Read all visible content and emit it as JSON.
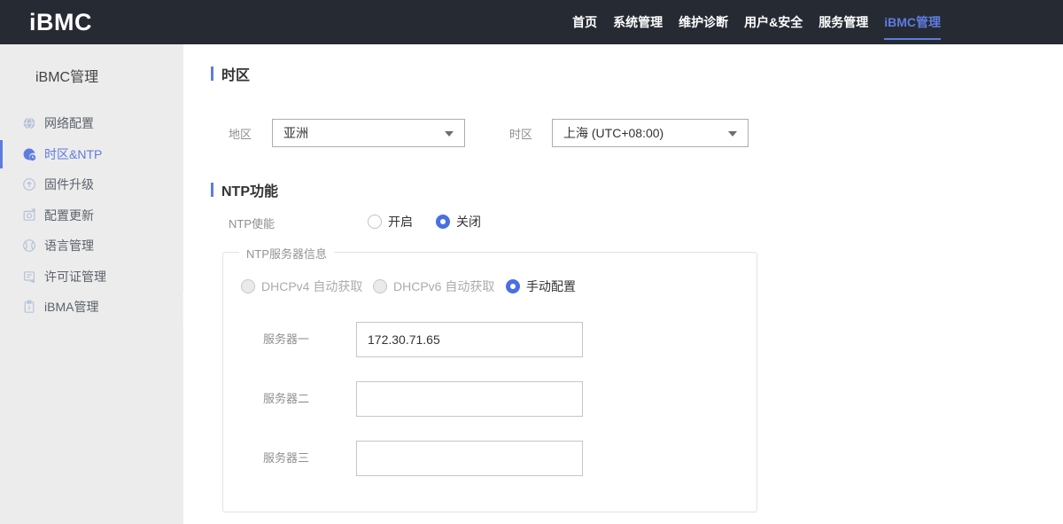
{
  "header": {
    "logo": "iBMC",
    "nav": [
      {
        "label": "首页",
        "active": false
      },
      {
        "label": "系统管理",
        "active": false
      },
      {
        "label": "维护诊断",
        "active": false
      },
      {
        "label": "用户&安全",
        "active": false
      },
      {
        "label": "服务管理",
        "active": false
      },
      {
        "label": "iBMC管理",
        "active": true
      }
    ]
  },
  "sidebar": {
    "title": "iBMC管理",
    "items": [
      {
        "label": "网络配置",
        "icon": "network-icon",
        "active": false
      },
      {
        "label": "时区&NTP",
        "icon": "timezone-ntp-icon",
        "active": true
      },
      {
        "label": "固件升级",
        "icon": "firmware-upgrade-icon",
        "active": false
      },
      {
        "label": "配置更新",
        "icon": "config-update-icon",
        "active": false
      },
      {
        "label": "语言管理",
        "icon": "language-icon",
        "active": false
      },
      {
        "label": "许可证管理",
        "icon": "license-icon",
        "active": false
      },
      {
        "label": "iBMA管理",
        "icon": "ibma-icon",
        "active": false
      }
    ],
    "collapse_icon": "chevron-left-icon"
  },
  "main": {
    "timezone_section": {
      "title": "时区",
      "region_label": "地区",
      "region_value": "亚洲",
      "zone_label": "时区",
      "zone_value": "上海 (UTC+08:00)"
    },
    "ntp_section": {
      "title": "NTP功能",
      "enable_label": "NTP使能",
      "enable_options": [
        {
          "label": "开启",
          "checked": false
        },
        {
          "label": "关闭",
          "checked": true
        }
      ],
      "server_group": {
        "legend": "NTP服务器信息",
        "modes": [
          {
            "label": "DHCPv4 自动获取",
            "checked": false,
            "disabled": true
          },
          {
            "label": "DHCPv6 自动获取",
            "checked": false,
            "disabled": true
          },
          {
            "label": "手动配置",
            "checked": true,
            "disabled": false
          }
        ],
        "servers": [
          {
            "label": "服务器一",
            "value": "172.30.71.65"
          },
          {
            "label": "服务器二",
            "value": ""
          },
          {
            "label": "服务器三",
            "value": ""
          }
        ]
      }
    }
  },
  "colors": {
    "accent": "#5e7ce0",
    "radio_checked": "#4a6fe3",
    "header_bg": "#262a33",
    "sidebar_bg": "#ececec"
  }
}
